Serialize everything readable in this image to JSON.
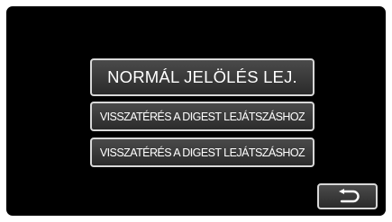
{
  "menu": {
    "option_1_label": "NORMÁL JELÖLÉS LEJ.",
    "option_2_label": "VISSZATÉRÉS A DIGEST LEJÁTSZÁSHOZ",
    "option_3_label": "VISSZATÉRÉS A DIGEST LEJÁTSZÁSHOZ"
  },
  "controls": {
    "back_icon": "return-arrow-icon"
  },
  "colors": {
    "screen_background": "#000000",
    "frame": "#ffffff",
    "button_fill": "#3a3a3a",
    "button_border": "#d8d8d8",
    "text": "#ffffff"
  }
}
